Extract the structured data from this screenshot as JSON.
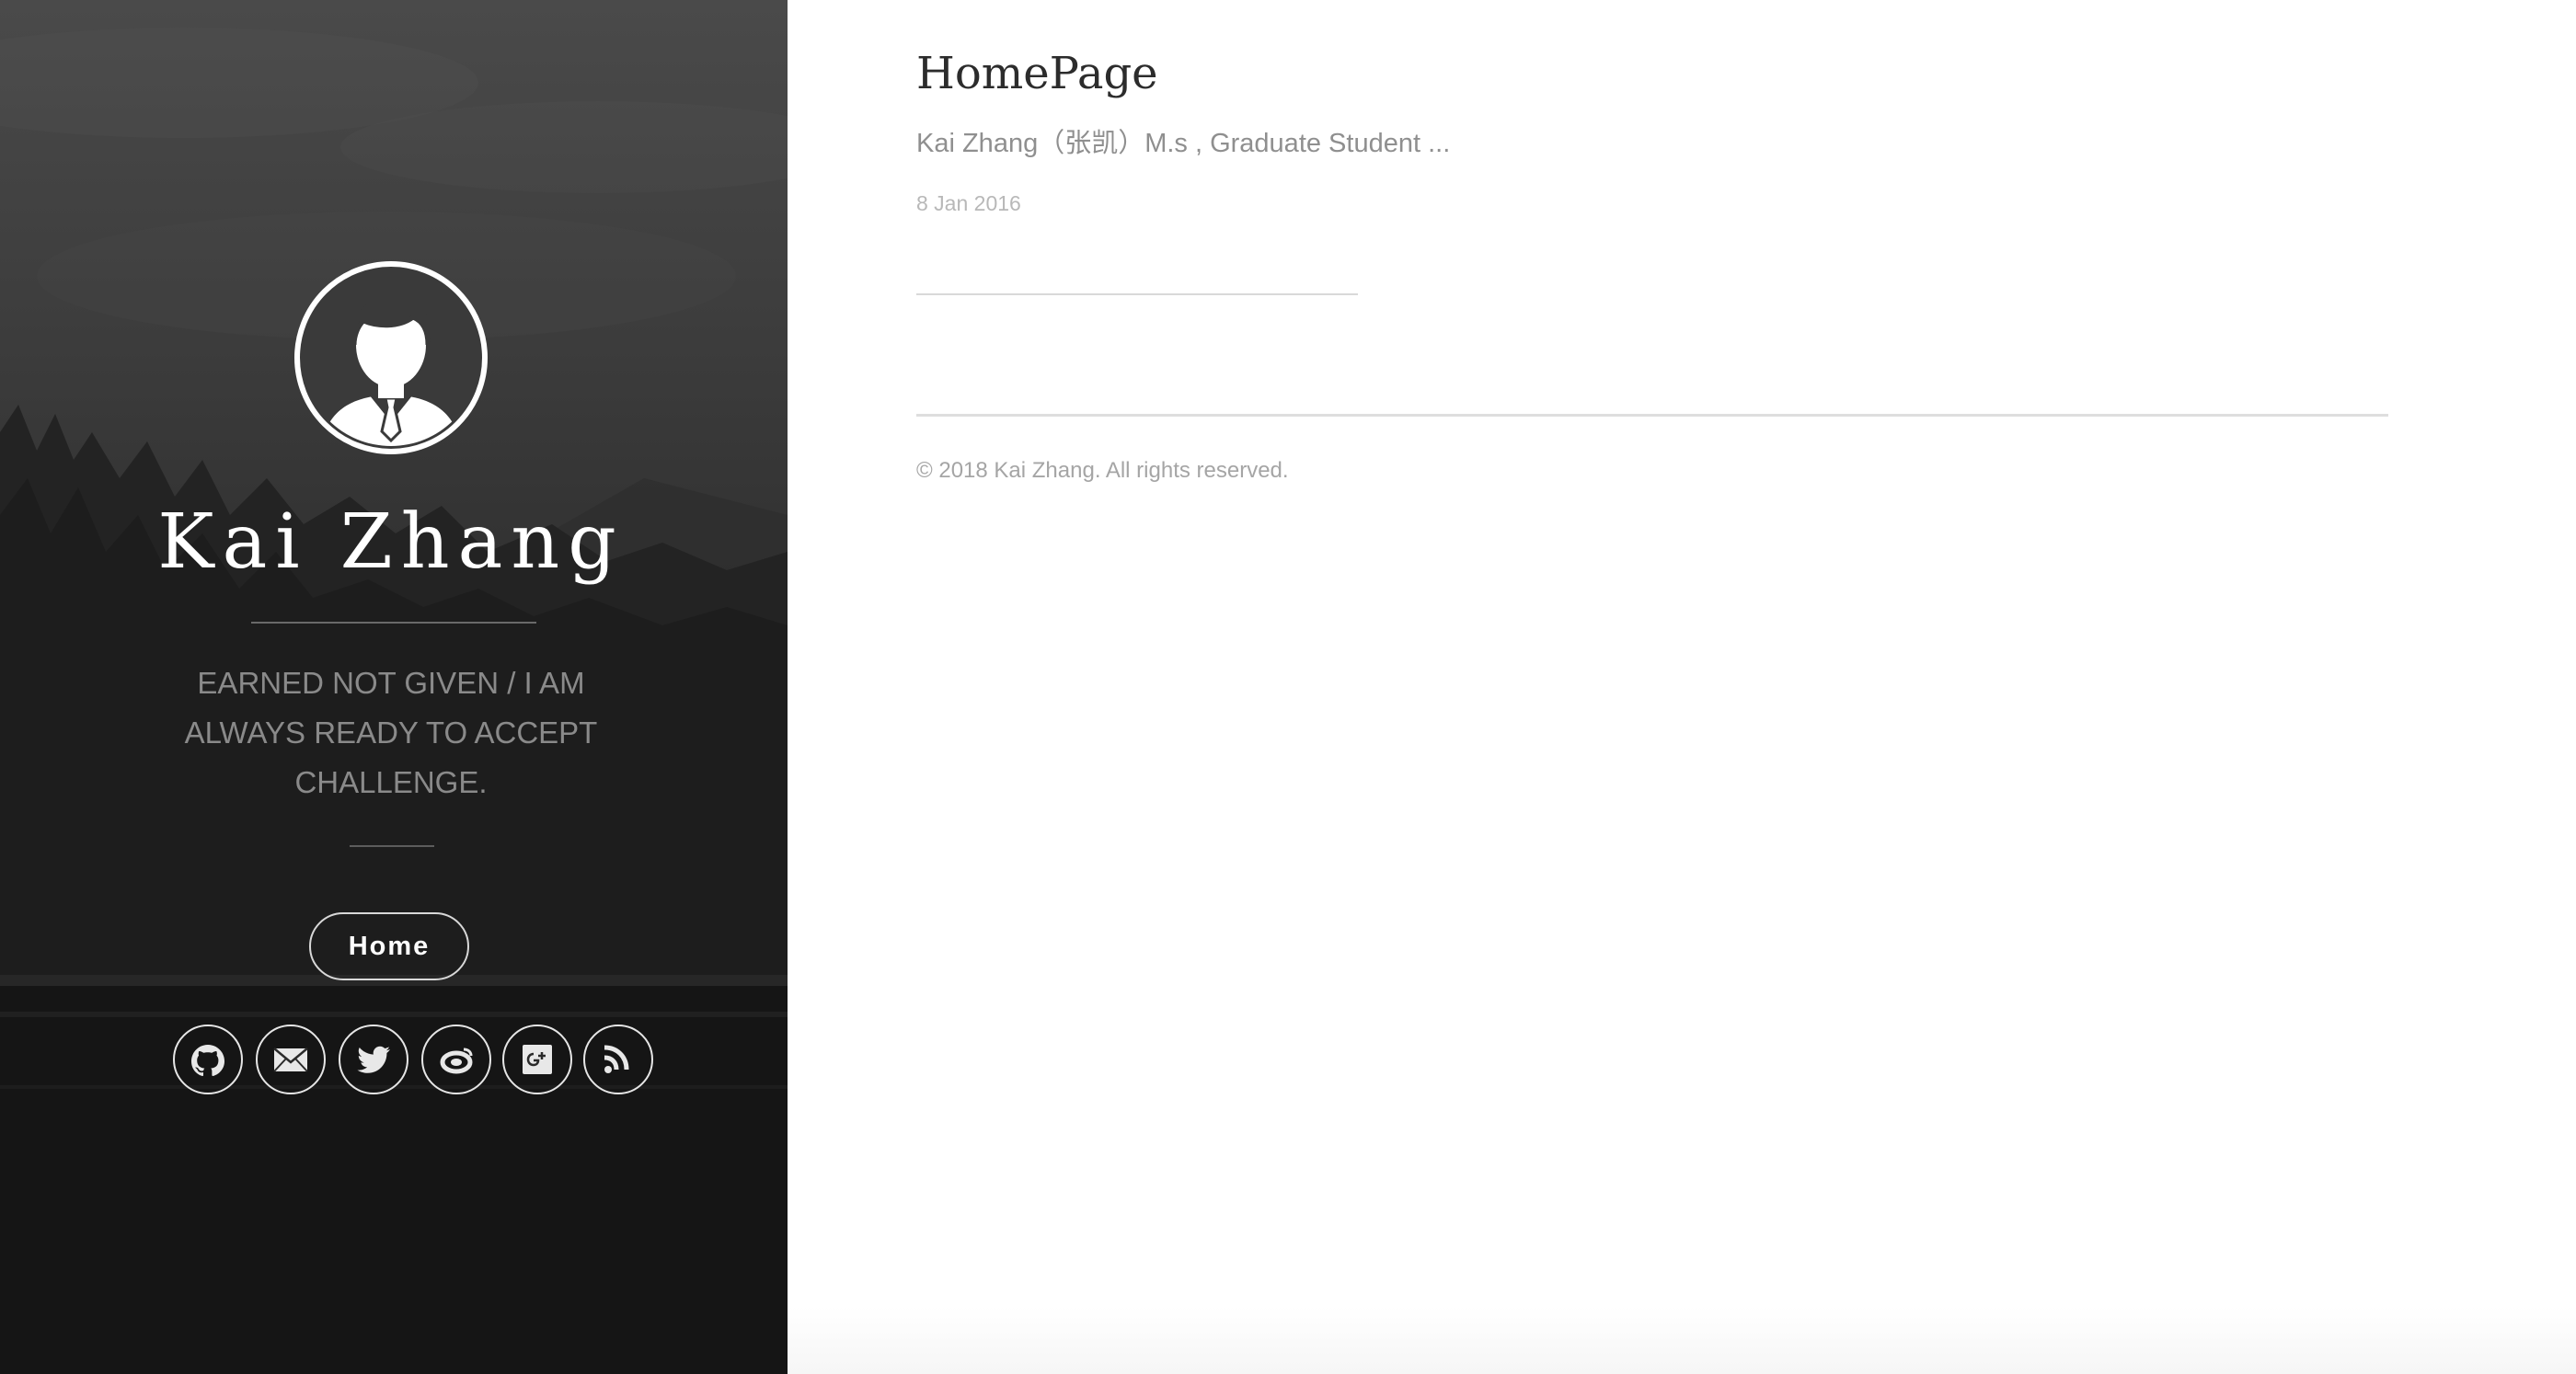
{
  "sidebar": {
    "title": "Kai Zhang",
    "tagline": "EARNED NOT GIVEN / I AM ALWAYS READY TO ACCEPT CHALLENGE.",
    "nav": [
      {
        "label": "Home"
      }
    ],
    "social": [
      {
        "icon": "github-icon"
      },
      {
        "icon": "email-icon"
      },
      {
        "icon": "twitter-icon"
      },
      {
        "icon": "weibo-icon"
      },
      {
        "icon": "google-plus-icon"
      },
      {
        "icon": "rss-icon"
      }
    ]
  },
  "main": {
    "post": {
      "title": "HomePage",
      "excerpt": "Kai Zhang（张凯）M.s , Graduate Student ...",
      "date": "8 Jan 2016"
    },
    "footer": {
      "copyright": "© 2018 Kai Zhang. All rights reserved."
    }
  },
  "colors": {
    "sidebar_bg": "#2f2f2f",
    "main_bg": "#ffffff",
    "title_text": "#2c2c2c",
    "muted_text": "#8f8f8f"
  }
}
